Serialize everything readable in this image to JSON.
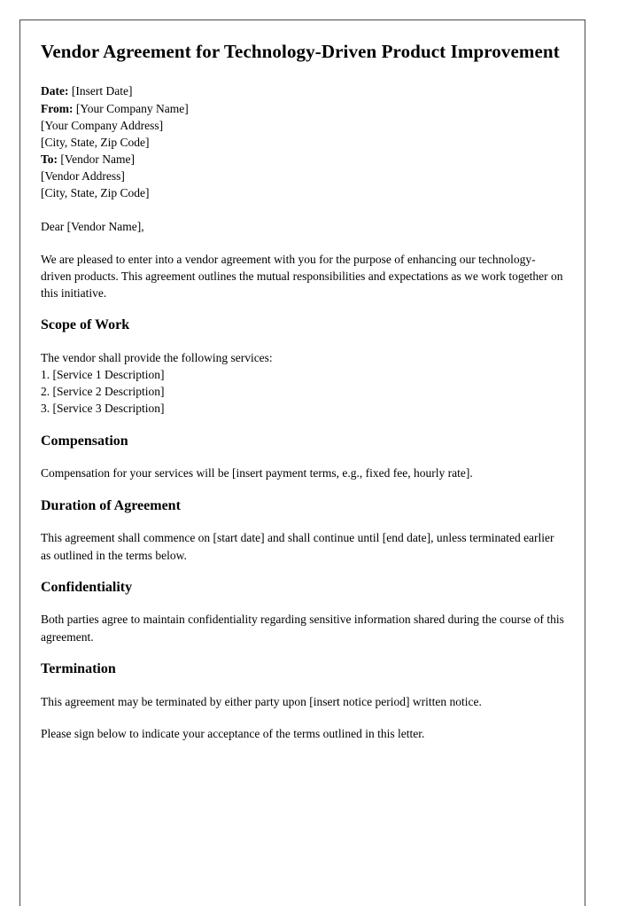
{
  "document": {
    "title": "Vendor Agreement for Technology-Driven Product Improvement",
    "address_block": {
      "date_label": "Date:",
      "date_value": " [Insert Date]",
      "from_label": "From:",
      "from_value": " [Your Company Name]",
      "company_address": "[Your Company Address]",
      "company_city_state_zip": "[City, State, Zip Code]",
      "to_label": "To:",
      "to_value": " [Vendor Name]",
      "vendor_address": "[Vendor Address]",
      "vendor_city_state_zip": "[City, State, Zip Code]"
    },
    "salutation": "Dear [Vendor Name],",
    "intro_paragraph": "We are pleased to enter into a vendor agreement with you for the purpose of enhancing our technology-driven products. This agreement outlines the mutual responsibilities and expectations as we work together on this initiative.",
    "sections": {
      "scope": {
        "heading": "Scope of Work",
        "intro": "The vendor shall provide the following services:",
        "items": [
          "1. [Service 1 Description]",
          "2. [Service 2 Description]",
          "3. [Service 3 Description]"
        ]
      },
      "compensation": {
        "heading": "Compensation",
        "paragraph": "Compensation for your services will be [insert payment terms, e.g., fixed fee, hourly rate]."
      },
      "duration": {
        "heading": "Duration of Agreement",
        "paragraph": "This agreement shall commence on [start date] and shall continue until [end date], unless terminated earlier as outlined in the terms below."
      },
      "confidentiality": {
        "heading": "Confidentiality",
        "paragraph": "Both parties agree to maintain confidentiality regarding sensitive information shared during the course of this agreement."
      },
      "termination": {
        "heading": "Termination",
        "paragraph": "This agreement may be terminated by either party upon [insert notice period] written notice."
      }
    },
    "closing_paragraph": "Please sign below to indicate your acceptance of the terms outlined in this letter."
  }
}
